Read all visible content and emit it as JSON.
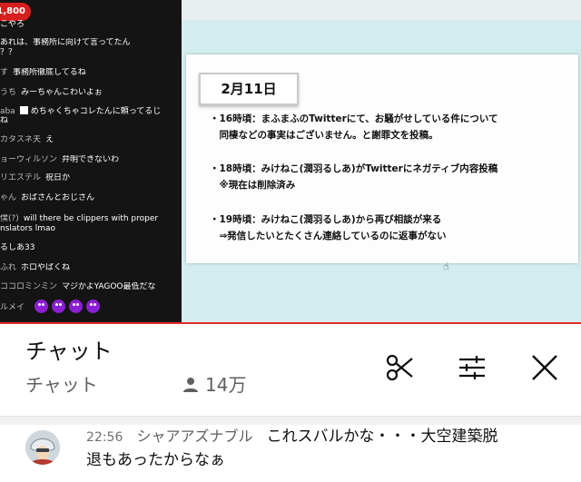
{
  "video": {
    "superchat_amount": "¥1,800",
    "overlay_chat": [
      {
        "name": "",
        "text": "こやろ"
      },
      {
        "name": "",
        "text": "あれは、事務所に向けて言ってたん"
      },
      {
        "name": "",
        "text": "？？"
      },
      {
        "name": "す",
        "text": "事務所徹底してるね"
      },
      {
        "name": "うち",
        "text": "みーちゃんこわいよぉ"
      },
      {
        "name": "aba",
        "text": "めちゃくちゃコレたんに頼ってるじ"
      },
      {
        "name": "",
        "text": "ね"
      },
      {
        "name": "カタスネ夫",
        "text": "え"
      },
      {
        "name": "ョーウィルソン",
        "text": "弁明できないわ"
      },
      {
        "name": "リエステル",
        "text": "祝日か"
      },
      {
        "name": "ゃん",
        "text": "おばさんとおじさん"
      },
      {
        "name": "僕(?)",
        "text": "will there be clippers with proper"
      },
      {
        "name": "",
        "text": "nslators lmao"
      },
      {
        "name": "",
        "text": "るしあ33"
      },
      {
        "name": "ふれ",
        "text": "ホロやばくね"
      },
      {
        "name": "ココロミンミン",
        "text": "マジかよYAGOO最低だな"
      }
    ],
    "overlay_emote_author": "ルメイ",
    "slide": {
      "date": "2月11日",
      "lines": [
        "・16時頃：まふまふのTwitterにて、お騒がせしている件について",
        "　同棲などの事実はございません。と謝罪文を投稿。",
        "・18時頃：みけねこ(潤羽るしあ)がTwitterにネガティブ内容投稿",
        "　※現在は削除済み",
        "・19時頃：みけねこ(潤羽るしあ)から再び相談が来る",
        "　⇒発信したいとたくさん連絡しているのに返事がない"
      ]
    }
  },
  "chat_header": {
    "title": "チャット",
    "subtitle": "チャット",
    "viewers": "14万",
    "icons": [
      "scissors-icon",
      "tune-icon",
      "close-icon"
    ]
  },
  "message": {
    "time": "22:56",
    "author": "シャアアズナブル",
    "text_line1": "これスバルかな・・・大空建築脱",
    "text_line2": "退もあったからなぁ"
  },
  "colors": {
    "progress": "#e52b2b",
    "superchat": "#d6201f",
    "emote": "#8b1fd1"
  }
}
